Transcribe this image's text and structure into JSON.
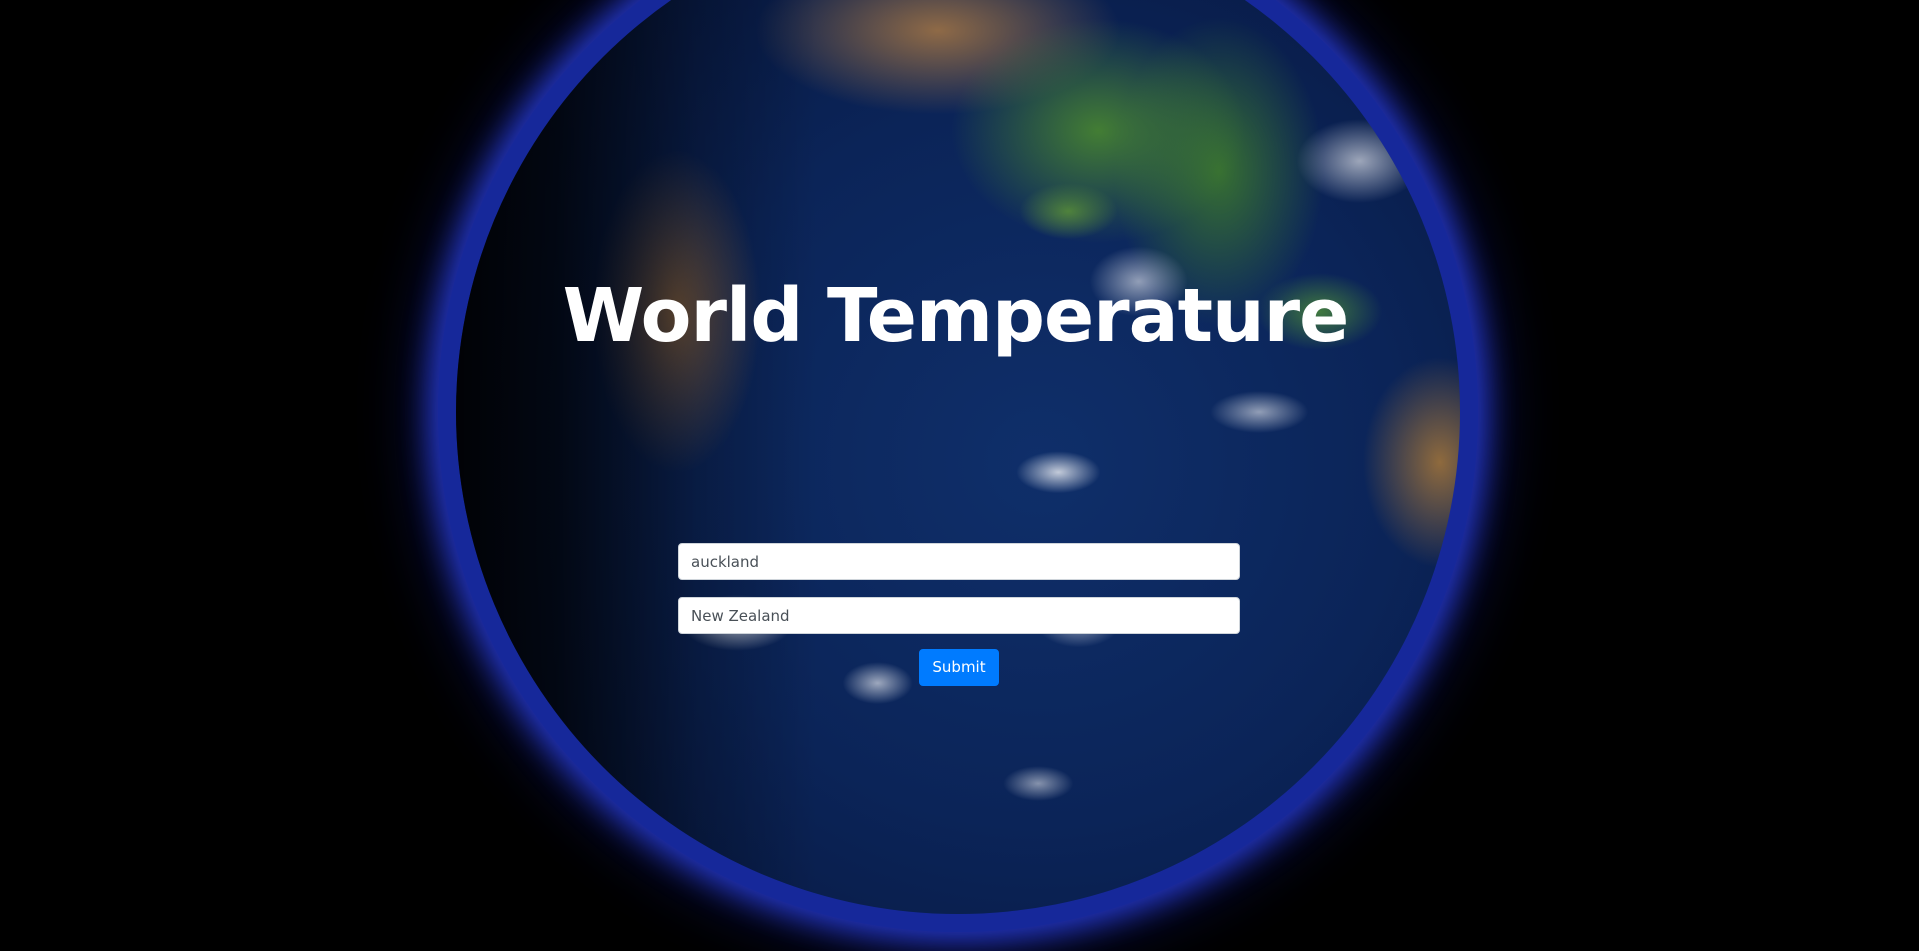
{
  "page": {
    "background_color": "#000000"
  },
  "hero": {
    "background_image": "earth-globe-image",
    "title": "World Temperature"
  },
  "form": {
    "city_value": "auckland",
    "country_value": "New Zealand",
    "submit_label": "Submit",
    "submit_color": "#007bff"
  }
}
